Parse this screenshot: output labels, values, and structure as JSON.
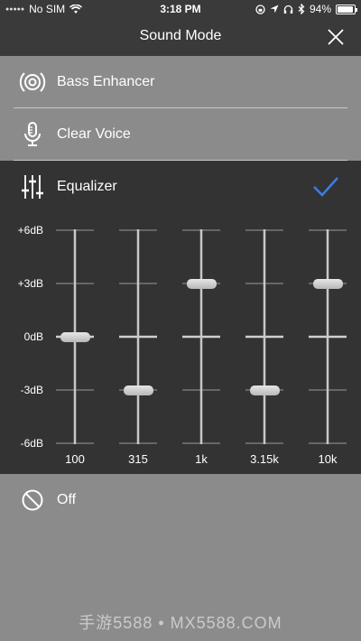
{
  "status": {
    "carrier": "No SIM",
    "time": "3:18 PM",
    "battery": "94%",
    "battery_level": 0.94,
    "icons": [
      "signal-dots-icon",
      "wifi-icon",
      "rotation-lock-icon",
      "location-icon",
      "headphones-icon",
      "bluetooth-icon",
      "battery-icon"
    ]
  },
  "nav": {
    "title": "Sound Mode",
    "close_icon": "close-icon"
  },
  "modes": [
    {
      "label": "Bass Enhancer",
      "icon": "speaker-icon",
      "selected": false
    },
    {
      "label": "Clear Voice",
      "icon": "microphone-icon",
      "selected": false
    },
    {
      "label": "Equalizer",
      "icon": "sliders-icon",
      "selected": true
    },
    {
      "label": "Off",
      "icon": "off-icon",
      "selected": false
    }
  ],
  "equalizer": {
    "db_scale": [
      "+6dB",
      "+3dB",
      "0dB",
      "-3dB",
      "-6dB"
    ],
    "bands": [
      {
        "freq": "100",
        "gain_db": 0
      },
      {
        "freq": "315",
        "gain_db": -3
      },
      {
        "freq": "1k",
        "gain_db": 3
      },
      {
        "freq": "3.15k",
        "gain_db": -3
      },
      {
        "freq": "10k",
        "gain_db": 3
      }
    ],
    "range_db": [
      -6,
      6
    ]
  },
  "colors": {
    "accent_check": "#3b7de0",
    "dark_bg": "#333333",
    "light_bg": "#8b8b8b"
  },
  "watermark": "手游5588 • MX5588.COM"
}
